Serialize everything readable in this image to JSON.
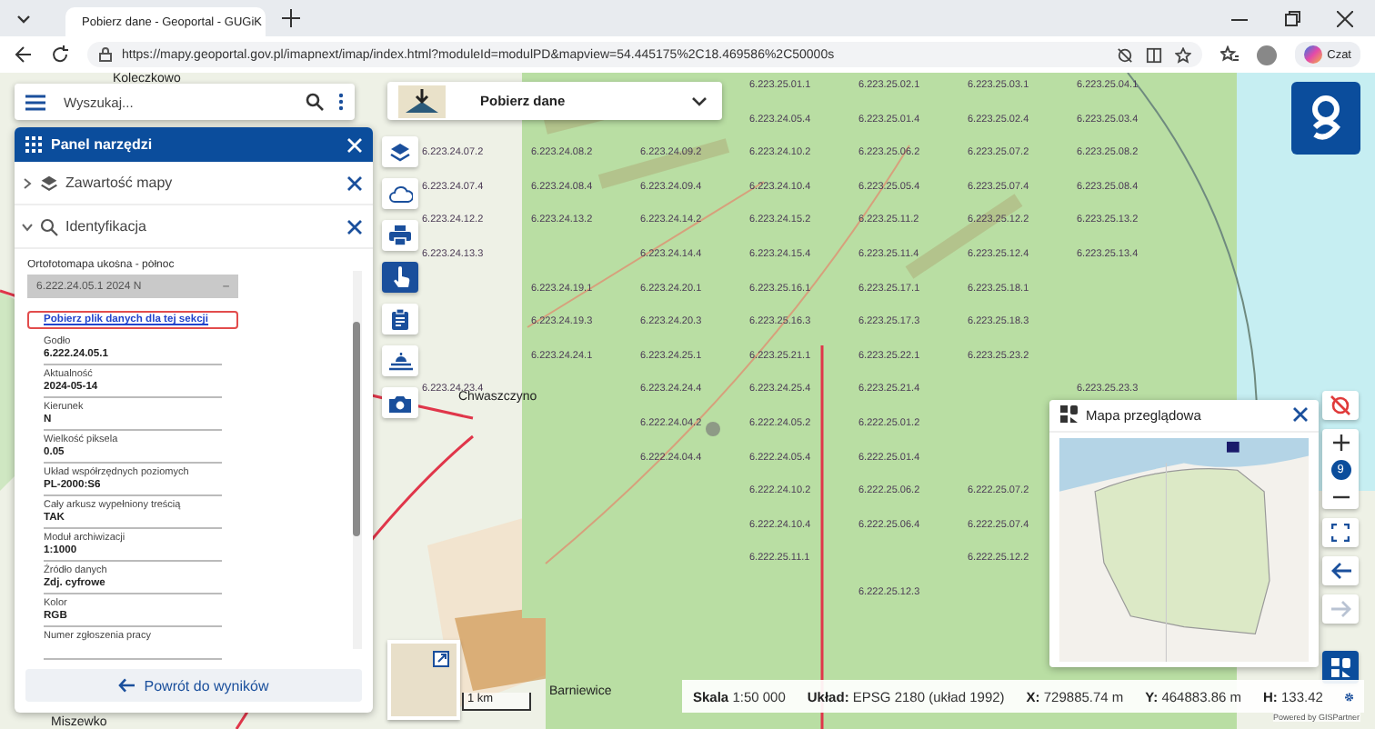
{
  "browser": {
    "tab_title": "Pobierz dane - Geoportal - GUGiK",
    "url": "https://mapy.geoportal.gov.pl/imapnext/imap/index.html?moduleId=modulPD&mapview=54.445175%2C18.469586%2C50000s",
    "copilot_label": "Czat"
  },
  "search": {
    "placeholder": "Wyszukaj..."
  },
  "tool_select": {
    "label": "Pobierz dane"
  },
  "tools_panel": {
    "title": "Panel narzędzi",
    "sections": [
      {
        "title": "Zawartość mapy",
        "expanded": false
      },
      {
        "title": "Identyfikacja",
        "expanded": true
      }
    ],
    "layer_name": "Ortofotomapa ukośna - północ",
    "result": "6.222.24.05.1 2024 N",
    "result_toggle": "–",
    "download_link": "Pobierz plik danych dla tej sekcji",
    "fields": [
      {
        "label": "Godło",
        "value": "6.222.24.05.1"
      },
      {
        "label": "Aktualność",
        "value": "2024-05-14"
      },
      {
        "label": "Kierunek",
        "value": "N"
      },
      {
        "label": "Wielkość piksela",
        "value": "0.05"
      },
      {
        "label": "Układ współrzędnych poziomych",
        "value": "PL-2000:S6"
      },
      {
        "label": "Cały arkusz wypełniony treścią",
        "value": "TAK"
      },
      {
        "label": "Moduł archiwizacji",
        "value": "1:1000"
      },
      {
        "label": "Źródło danych",
        "value": "Zdj. cyfrowe"
      },
      {
        "label": "Kolor",
        "value": "RGB"
      },
      {
        "label": "Numer zgłoszenia pracy"
      }
    ],
    "back_button": "Powrót do wyników"
  },
  "toolbar": [
    {
      "kind": "layers",
      "selected": false
    },
    {
      "kind": "cloud",
      "selected": false
    },
    {
      "kind": "print",
      "selected": false
    },
    {
      "kind": "hand",
      "selected": true
    },
    {
      "kind": "clipboard",
      "selected": false
    },
    {
      "kind": "coast",
      "selected": false
    },
    {
      "kind": "camera",
      "selected": false
    }
  ],
  "map": {
    "places": [
      "Koleczkowo",
      "Chwaszczyno",
      "Barniewice",
      "Miszewko"
    ],
    "grid_rows": [
      [
        null,
        null,
        null,
        "6.223.25.01.1",
        "6.223.25.02.1",
        "6.223.25.03.1",
        "6.223.25.04.1"
      ],
      [
        null,
        null,
        null,
        "6.223.24.05.4",
        "6.223.25.01.4",
        "6.223.25.02.4",
        "6.223.25.03.4"
      ],
      [
        "6.223.24.07.2",
        "6.223.24.08.2",
        "6.223.24.09.2",
        "6.223.24.10.2",
        "6.223.25.06.2",
        "6.223.25.07.2",
        "6.223.25.08.2"
      ],
      [
        "6.223.24.07.4",
        "6.223.24.08.4",
        "6.223.24.09.4",
        "6.223.24.10.4",
        "6.223.25.05.4",
        "6.223.25.07.4",
        "6.223.25.08.4"
      ],
      [
        "6.223.24.12.2",
        "6.223.24.13.2",
        "6.223.24.14.2",
        "6.223.24.15.2",
        "6.223.25.11.2",
        "6.223.25.12.2",
        "6.223.25.13.2"
      ],
      [
        "6.223.24.13.3",
        null,
        "6.223.24.14.4",
        "6.223.24.15.4",
        "6.223.25.11.4",
        "6.223.25.12.4",
        "6.223.25.13.4"
      ],
      [
        null,
        "6.223.24.19.1",
        "6.223.24.20.1",
        "6.223.25.16.1",
        "6.223.25.17.1",
        "6.223.25.18.1"
      ],
      [
        null,
        "6.223.24.19.3",
        "6.223.24.20.3",
        "6.223.25.16.3",
        "6.223.25.17.3",
        "6.223.25.18.3"
      ],
      [
        null,
        "6.223.24.24.1",
        "6.223.24.25.1",
        "6.223.25.21.1",
        "6.223.25.22.1",
        "6.223.25.23.2"
      ],
      [
        "6.223.24.23.4",
        null,
        "6.223.24.24.4",
        "6.223.24.25.4",
        "6.223.25.21.4",
        null,
        "6.223.25.23.3"
      ],
      [
        null,
        null,
        "6.222.24.04.2",
        "6.222.24.05.2",
        "6.222.25.01.2"
      ],
      [
        null,
        null,
        "6.222.24.04.4",
        "6.222.24.05.4",
        "6.222.25.01.4"
      ],
      [
        null,
        null,
        null,
        "6.222.24.10.2",
        "6.222.25.06.2",
        "6.222.25.07.2"
      ],
      [
        null,
        null,
        null,
        "6.222.24.10.4",
        "6.222.25.06.4",
        "6.222.25.07.4"
      ],
      [
        null,
        null,
        null,
        "6.222.25.11.1",
        null,
        "6.222.25.12.2"
      ],
      [
        null,
        null,
        null,
        null,
        "6.222.25.12.3"
      ]
    ],
    "scale_bar": "1 km"
  },
  "overview": {
    "title": "Mapa przeglądowa"
  },
  "map_controls": {
    "zoom_level": "9",
    "forward_disabled": true
  },
  "status_bar": {
    "scale_label": "Skala",
    "scale": "1:50 000",
    "crs_label": "Układ:",
    "crs": "EPSG 2180 (układ 1992)",
    "x_label": "X:",
    "x": "729885.74 m",
    "y_label": "Y:",
    "y": "464883.86 m",
    "h_label": "H:",
    "h": "133.42"
  },
  "attribution": "Powered by GISPartner"
}
